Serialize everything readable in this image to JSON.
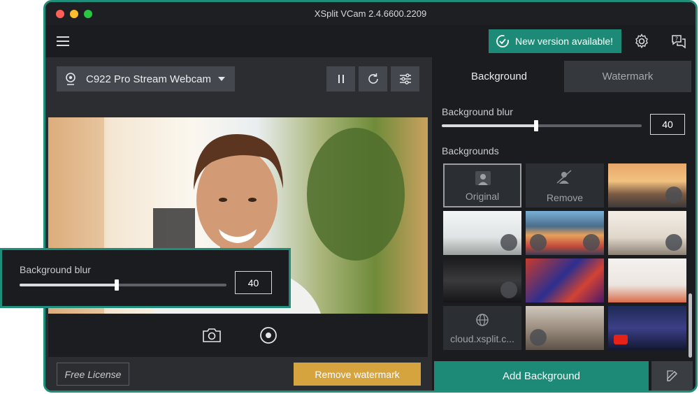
{
  "window": {
    "title": "XSplit VCam 2.4.6600.2209"
  },
  "header": {
    "menu_icon": "hamburger-icon",
    "update_label": "New version available!",
    "settings_icon": "gear-icon",
    "help_icon": "help-chat-icon"
  },
  "camera": {
    "selected_device": "C922 Pro Stream Webcam",
    "controls": [
      "pause-icon",
      "refresh-icon",
      "sliders-icon"
    ]
  },
  "video_bar": {
    "snapshot_icon": "camera-icon",
    "record_icon": "record-icon"
  },
  "footer": {
    "license_label": "Free License",
    "remove_watermark_label": "Remove watermark"
  },
  "tabs": [
    {
      "label": "Background",
      "active": true
    },
    {
      "label": "Watermark",
      "active": false
    }
  ],
  "blur": {
    "label": "Background blur",
    "value": "40",
    "fraction": 0.47
  },
  "backgrounds": {
    "label": "Backgrounds",
    "tiles": [
      {
        "label": "Original",
        "kind": "original"
      },
      {
        "label": "Remove",
        "kind": "remove"
      },
      {
        "label": "",
        "kind": "image"
      },
      {
        "label": "",
        "kind": "image"
      },
      {
        "label": "",
        "kind": "video"
      },
      {
        "label": "",
        "kind": "image"
      },
      {
        "label": "",
        "kind": "image"
      },
      {
        "label": "",
        "kind": "image"
      },
      {
        "label": "",
        "kind": "image"
      },
      {
        "label": "cloud.xsplit.c...",
        "kind": "cloud"
      },
      {
        "label": "",
        "kind": "video"
      },
      {
        "label": "",
        "kind": "youtube"
      }
    ]
  },
  "add_background_label": "Add Background",
  "edit_icon": "pencil-icon",
  "callout": {
    "label": "Background blur",
    "value": "40",
    "fraction": 0.47
  },
  "colors": {
    "accent": "#1c8a76",
    "warning": "#d6a43e",
    "frame": "#1f8f7c"
  }
}
